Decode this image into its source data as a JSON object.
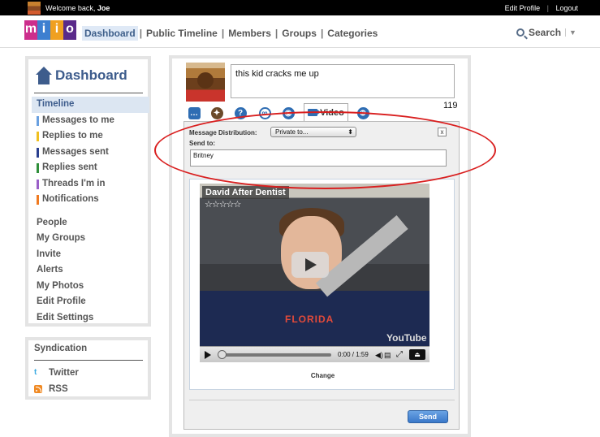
{
  "topbar": {
    "welcome_prefix": "Welcome back,",
    "user_name": "Joe",
    "edit_profile": "Edit Profile",
    "separator": "|",
    "logout": "Logout"
  },
  "logo": {
    "letters": [
      "m",
      "i",
      "i",
      "o"
    ],
    "colors": [
      "#cc2e8c",
      "#3d7fd0",
      "#f0a020",
      "#5a2a8a"
    ]
  },
  "nav": {
    "items": [
      "Dashboard",
      "Public Timeline",
      "Members",
      "Groups",
      "Categories"
    ],
    "search_label": "Search"
  },
  "sidebar": {
    "title": "Dashboard",
    "items": [
      {
        "label": "Timeline",
        "selected": true
      },
      {
        "label": "Messages to me",
        "color": "#6aa0e0"
      },
      {
        "label": "Replies to me",
        "color": "#f0c020"
      },
      {
        "label": "Messages sent",
        "color": "#2a3f8f"
      },
      {
        "label": "Replies sent",
        "color": "#2f8f3a"
      },
      {
        "label": "Threads I'm in",
        "color": "#9a5fc8"
      },
      {
        "label": "Notifications",
        "color": "#f07a20"
      }
    ],
    "items2": [
      "People",
      "My Groups",
      "Invite",
      "Alerts",
      "My Photos",
      "Edit Profile",
      "Edit Settings"
    ]
  },
  "syndication": {
    "title": "Syndication",
    "twitter": "Twitter",
    "rss": "RSS"
  },
  "compose": {
    "text": "this kid cracks me up",
    "counter": "119"
  },
  "tabs": {
    "video_label": "Video",
    "icons": [
      "comment-icon",
      "thumbs-up-icon",
      "question-icon",
      "link-icon",
      "camera-icon",
      "video-icon",
      "globe-icon"
    ]
  },
  "distribution": {
    "label": "Message Distribution:",
    "selected": "Private to...",
    "close": "x",
    "send_to_label": "Send to:",
    "send_to_value": "Britney"
  },
  "video": {
    "title": "David After Dentist",
    "stars": "☆☆☆☆☆",
    "shirt_text": "FLORIDA",
    "youtube": "YouTube",
    "time": "0:00 / 1:59",
    "progress": 0,
    "change_label": "Change"
  },
  "send_button": "Send",
  "annotation_color": "#d91f1f"
}
